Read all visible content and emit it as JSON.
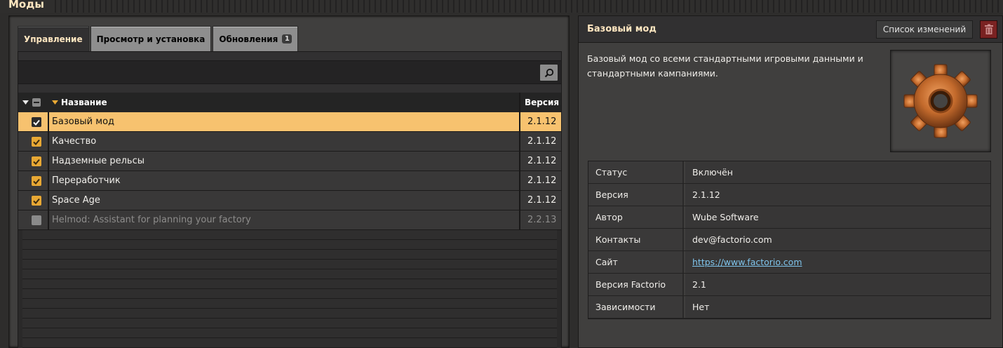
{
  "window": {
    "title": "Моды"
  },
  "tabs": [
    {
      "label": "Управление",
      "active": true
    },
    {
      "label": "Просмотр и установка",
      "active": false
    },
    {
      "label": "Обновления",
      "active": false,
      "badge": "1"
    }
  ],
  "search": {
    "icon": "search-icon"
  },
  "table": {
    "headers": {
      "name": "Название",
      "version": "Версия"
    },
    "rows": [
      {
        "name": "Базовый мод",
        "version": "2.1.12",
        "enabled": true,
        "selected": true
      },
      {
        "name": "Качество",
        "version": "2.1.12",
        "enabled": true,
        "selected": false
      },
      {
        "name": "Надземные рельсы",
        "version": "2.1.12",
        "enabled": true,
        "selected": false
      },
      {
        "name": "Переработчик",
        "version": "2.1.12",
        "enabled": true,
        "selected": false
      },
      {
        "name": "Space Age",
        "version": "2.1.12",
        "enabled": true,
        "selected": false
      },
      {
        "name": "Helmod: Assistant for planning your factory",
        "version": "2.2.13",
        "enabled": false,
        "selected": false
      }
    ]
  },
  "details": {
    "title": "Базовый мод",
    "changelog_label": "Список изменений",
    "delete_icon": "trash-icon",
    "description": "Базовый мод со всеми стандартными игровыми данными и стандартными кампаниями.",
    "thumbnail_icon": "gear-icon",
    "info": [
      {
        "key": "Статус",
        "value": "Включён"
      },
      {
        "key": "Версия",
        "value": "2.1.12"
      },
      {
        "key": "Автор",
        "value": "Wube Software"
      },
      {
        "key": "Контакты",
        "value": "dev@factorio.com"
      },
      {
        "key": "Сайт",
        "value": "https://www.factorio.com"
      },
      {
        "key": "Версия Factorio",
        "value": "2.1"
      },
      {
        "key": "Зависимости",
        "value": "Нет"
      }
    ]
  },
  "colors": {
    "accent": "#f7c26f",
    "checkbox_on": "#e8a834",
    "title_text": "#ffe6c0",
    "link": "#7fc4ec",
    "delete": "#7a2222"
  }
}
